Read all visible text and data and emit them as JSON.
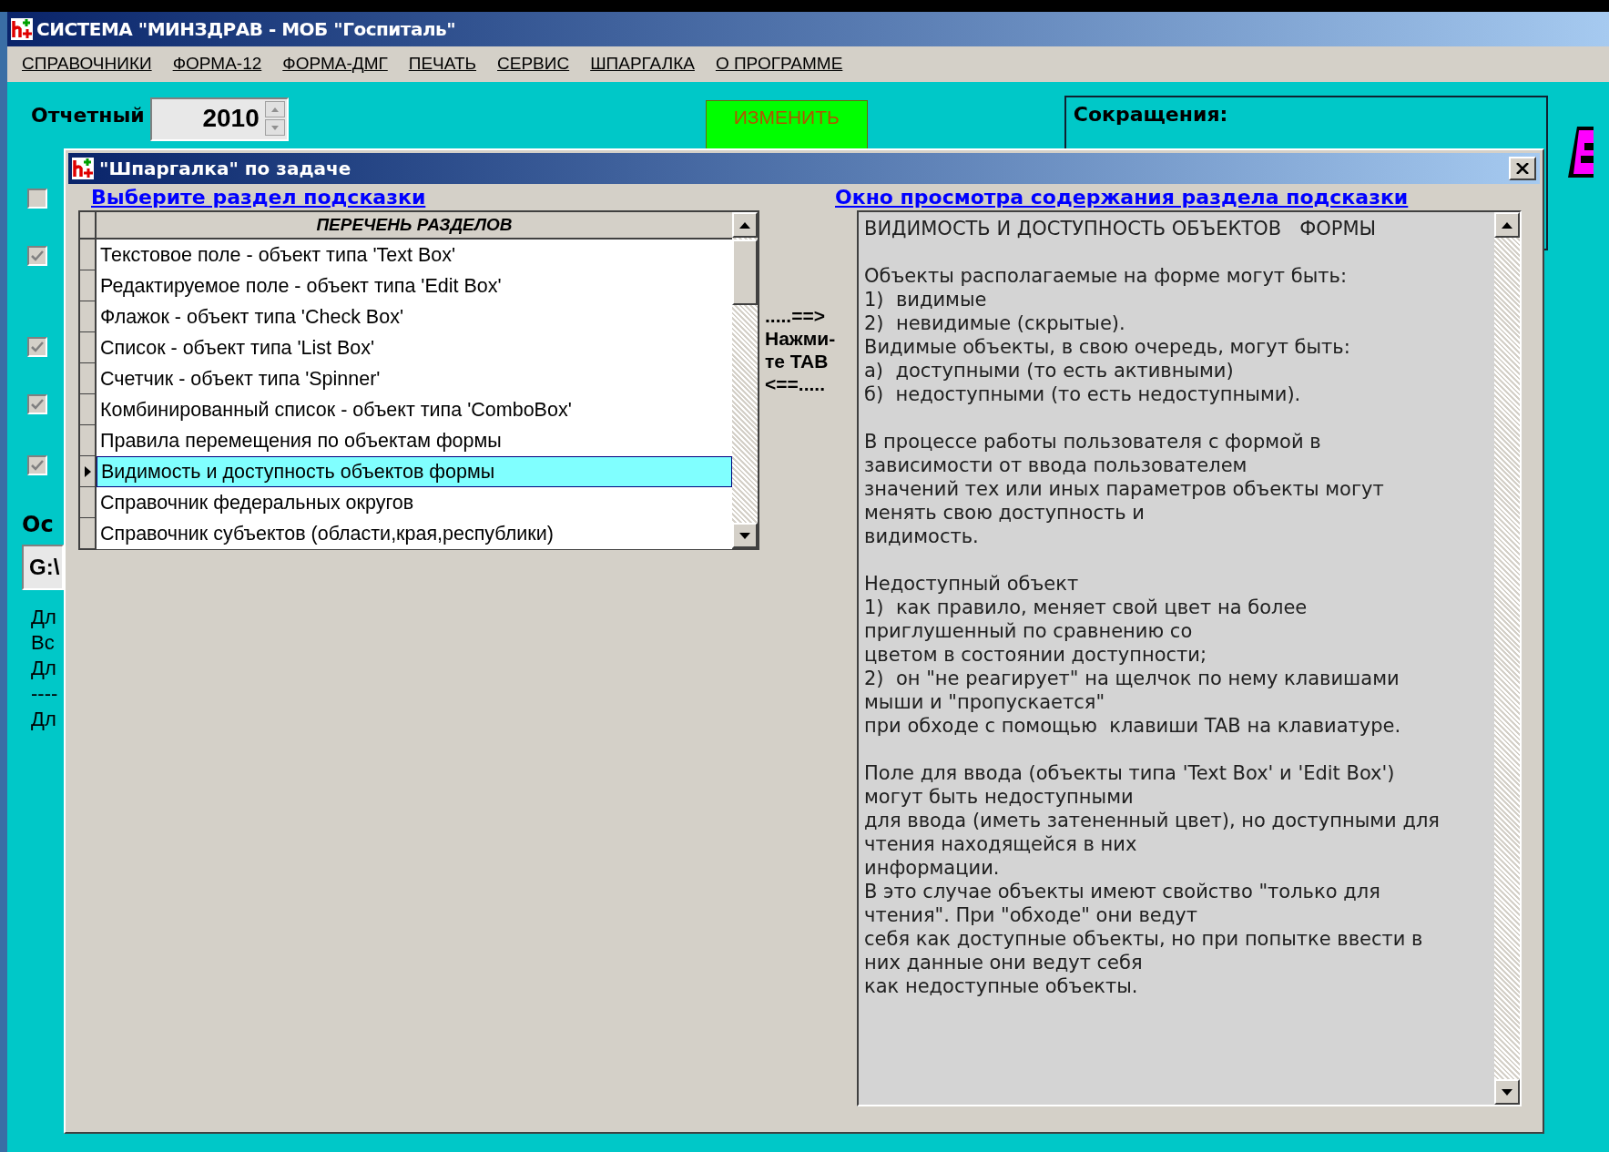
{
  "window": {
    "title": "СИСТЕМА \"МИНЗДРАВ - МОБ \"Госпиталь\""
  },
  "menu": [
    {
      "label": "СПРАВОЧНИКИ"
    },
    {
      "label": "ФОРМА-12"
    },
    {
      "label": "ФОРМА-ДМГ"
    },
    {
      "label": "ПЕЧАТЬ"
    },
    {
      "label": "СЕРВИС"
    },
    {
      "label": "ШПАРГАЛКА"
    },
    {
      "label": "О ПРОГРАММЕ"
    }
  ],
  "background": {
    "year_label": "Отчетный",
    "year_value": "2010",
    "change_button": "ИЗМЕНИТЬ",
    "abbrev_title": "Сокращения:",
    "checkboxes": [
      {
        "checked": false
      },
      {
        "checked": true
      },
      {
        "checked": true
      },
      {
        "checked": true
      },
      {
        "checked": true
      }
    ],
    "section_label": "Ос",
    "path_value": "G:\\",
    "notes": [
      "Дл",
      "Вс",
      "Дл",
      "----",
      "Дл"
    ]
  },
  "dialog": {
    "title": "\"Шпаргалка\" по задаче",
    "left_caption": "Выберите раздел  подсказки",
    "right_caption": "Окно просмотра содержания раздела подсказки",
    "list_header": "ПЕРЕЧЕНЬ  РАЗДЕЛОВ",
    "items": [
      {
        "label": "Текстовое поле - объект типа 'Text Box'",
        "selected": false
      },
      {
        "label": "Редактируемое поле - объект типа 'Edit Box'",
        "selected": false
      },
      {
        "label": "Флажок - объект типа 'Check Box'",
        "selected": false
      },
      {
        "label": "Список - объект типа 'List Box'",
        "selected": false
      },
      {
        "label": "Счетчик - объект типа 'Spinner'",
        "selected": false
      },
      {
        "label": "Комбинированный список - объект типа 'ComboBox'",
        "selected": false
      },
      {
        "label": "Правила перемещения по объектам формы",
        "selected": false
      },
      {
        "label": "Видимость и доступность объектов формы",
        "selected": true
      },
      {
        "label": "Справочник федеральных округов",
        "selected": false
      },
      {
        "label": "Справочник субъектов (области,края,республики)",
        "selected": false
      }
    ],
    "tab_hint": [
      ".....==>",
      "Нажми-",
      "те TAB",
      "<==....."
    ],
    "content_title": "ВИДИМОСТЬ И ДОСТУПНОСТЬ ОБЪЕКТОВ   ФОРМЫ",
    "paragraphs": [
      [
        "Объекты располагаемые на форме могут быть:",
        "1)  видимые",
        "2)  невидимые (скрытые).",
        "Видимые объекты, в свою очередь, могут быть:",
        "а)  доступными (то есть активными)",
        "б)  недоступными (то есть недоступными)."
      ],
      [
        "В процессе работы пользователя с формой в",
        "зависимости от ввода пользователем",
        "значений тех или иных параметров объекты могут",
        "менять свою доступность и",
        "видимость."
      ],
      [
        "Недоступный объект",
        "1)  как правило, меняет свой цвет на более",
        "приглушенный по сравнению со",
        "цветом в состоянии доступности;",
        "2)  он \"не реагирует\" на щелчок по нему клавишами",
        "мыши и \"пропускается\"",
        "при обходе с помощью  клавиши TAB на клавиатуре."
      ],
      [
        "Поле для ввода (объекты типа 'Text Box' и 'Edit Box')",
        "могут быть недоступными",
        "для ввода (иметь затененный цвет), но доступными для",
        "чтения находящейся в них",
        "информации.",
        "В это случае объекты имеют свойство \"только для",
        "чтения\". При \"обходе\" они ведут",
        "себя как доступные объекты, но при попытке ввести в",
        "них данные они ведут себя",
        "как недоступные объекты."
      ]
    ]
  }
}
